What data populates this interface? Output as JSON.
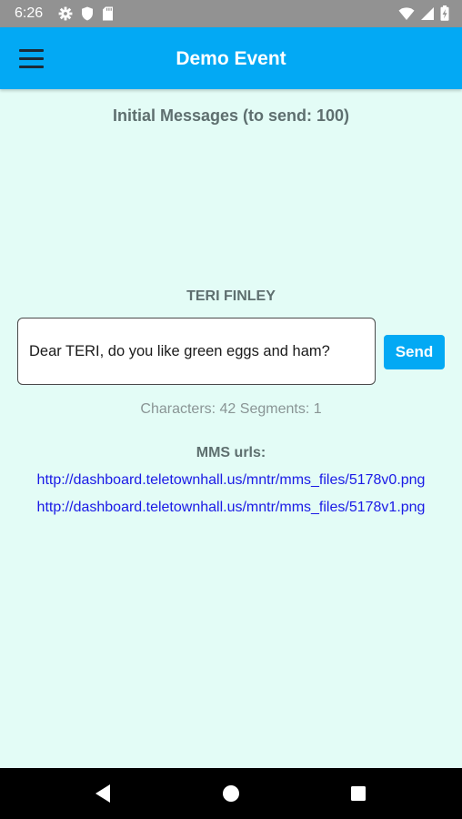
{
  "status_bar": {
    "time": "6:26",
    "left_icons": [
      "gear-icon",
      "shield-icon",
      "sd-card-icon"
    ],
    "right_icons": [
      "wifi-icon",
      "cell-signal-icon",
      "battery-icon"
    ]
  },
  "app_bar": {
    "title": "Demo Event",
    "menu_icon": "hamburger-menu-icon",
    "background": "#03a9f4"
  },
  "main": {
    "section_title": "Initial Messages (to send: 100)",
    "recipient": "TERI FINLEY",
    "message_text": "Dear TERI, do you like green eggs and ham?",
    "send_label": "Send",
    "char_count": "Characters: 42 Segments: 1",
    "mms_label": "MMS urls:",
    "mms_urls": [
      "http://dashboard.teletownhall.us/mntr/mms_files/5178v0.png",
      "http://dashboard.teletownhall.us/mntr/mms_files/5178v1.png"
    ]
  },
  "nav_bar": {
    "icons": [
      "back-icon",
      "home-icon",
      "recents-icon"
    ]
  },
  "colors": {
    "accent": "#03a9f4",
    "background": "#e3fcf6",
    "link": "#1a1ae6",
    "status_bar": "#929292"
  }
}
